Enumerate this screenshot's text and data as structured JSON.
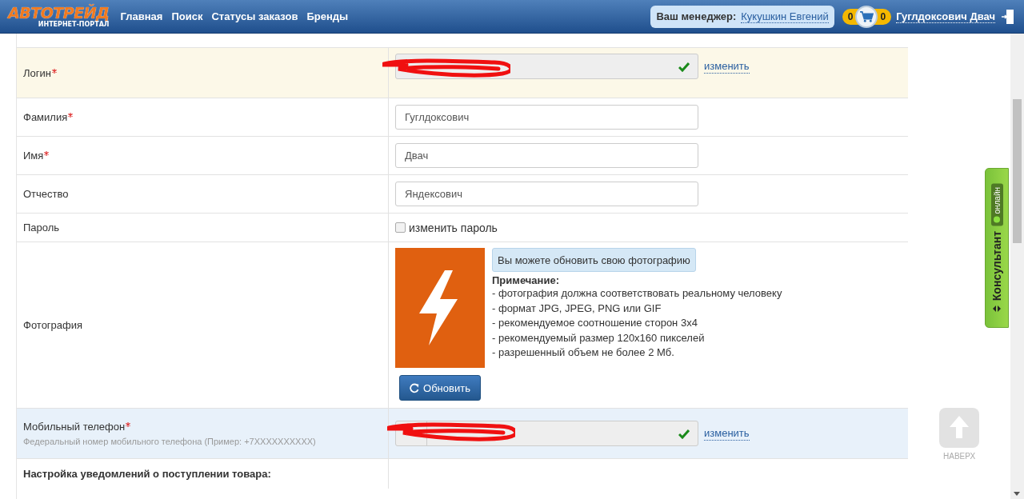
{
  "header": {
    "logo": {
      "name": "АВТОТРЕЙД",
      "tagline": "ИНТЕРНЕТ-ПОРТАЛ"
    },
    "nav": [
      "Главная",
      "Поиск",
      "Статусы заказов",
      "Бренды"
    ],
    "manager": {
      "label": "Ваш менеджер:",
      "name": "Кукушкин Евгений"
    },
    "cart": {
      "left_count": "0",
      "right_count": "0"
    },
    "user": "Гуглдоксович Двач"
  },
  "form_rows": [
    {
      "kind": "locked",
      "label": "Логин",
      "required": true,
      "verified": true,
      "link": "изменить"
    },
    {
      "kind": "text",
      "label": "Фамилия",
      "required": true,
      "value": "Гуглдоксович"
    },
    {
      "kind": "text",
      "label": "Имя",
      "required": true,
      "value": "Двач"
    },
    {
      "kind": "text",
      "label": "Отчество",
      "required": false,
      "value": "Яндексович"
    },
    {
      "kind": "checkbox",
      "label": "Пароль",
      "option": "изменить пароль",
      "checked": false
    },
    {
      "kind": "photo",
      "label": "Фотография",
      "upload_hint": "Вы можете обновить свою фотографию",
      "note_title": "Примечание:",
      "notes": [
        "- фотография должна соответствовать реальному человеку",
        "- формат JPG, JPEG, PNG или GIF",
        "- рекомендуемое соотношение сторон 3x4",
        "- рекомендуемый размер 120x160 пикселей",
        "- разрешенный объем не более 2 Мб."
      ],
      "button": "Обновить"
    },
    {
      "kind": "phone",
      "label": "Мобильный телефон",
      "required": true,
      "hint": "Федеральный номер мобильного телефона (Пример: +7XXXXXXXXXX)",
      "verified": true,
      "link": "изменить"
    },
    {
      "kind": "heading",
      "label": "Настройка уведомлений о поступлении товара:"
    }
  ],
  "consultant": {
    "label": "Консультант",
    "status": "онлайн",
    "online": true
  },
  "back_to_top": "НАВЕРХ"
}
